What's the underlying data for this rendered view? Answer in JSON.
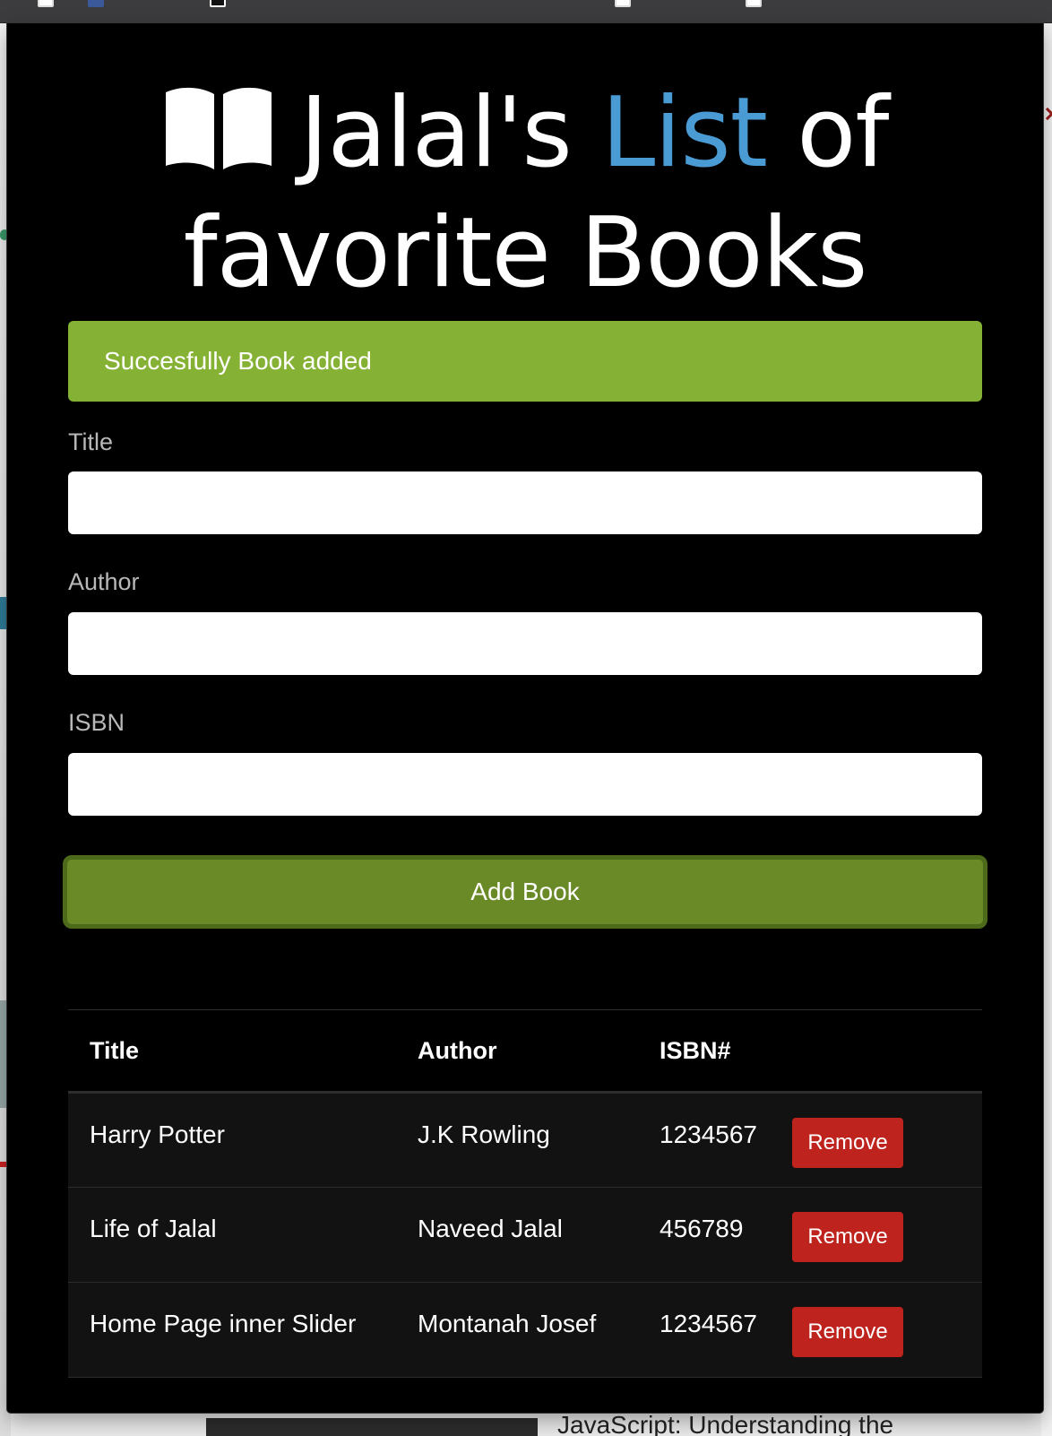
{
  "header": {
    "title_part1": "Jalal's",
    "title_accent": "List",
    "title_part2": "of",
    "title_line2": "favorite Books",
    "icon": "book-open-icon",
    "accent_color": "#4a9ad4"
  },
  "alert": {
    "message": "Succesfully Book added",
    "color": "#85b135"
  },
  "form": {
    "title_label": "Title",
    "title_value": "",
    "author_label": "Author",
    "author_value": "",
    "isbn_label": "ISBN",
    "isbn_value": "",
    "submit_label": "Add Book",
    "submit_color": "#6a8a27"
  },
  "table": {
    "headers": [
      "Title",
      "Author",
      "ISBN#"
    ],
    "rows": [
      {
        "title": "Harry Potter",
        "author": "J.K Rowling",
        "isbn": "1234567",
        "action": "Remove"
      },
      {
        "title": "Life of Jalal",
        "author": "Naveed Jalal",
        "isbn": "456789",
        "action": "Remove"
      },
      {
        "title": "Home Page inner Slider",
        "author": "Montanah Josef",
        "isbn": "1234567",
        "action": "Remove"
      }
    ],
    "remove_color": "#be241d"
  },
  "background_page": {
    "partial_heading": "JavaScript: Understanding the"
  }
}
